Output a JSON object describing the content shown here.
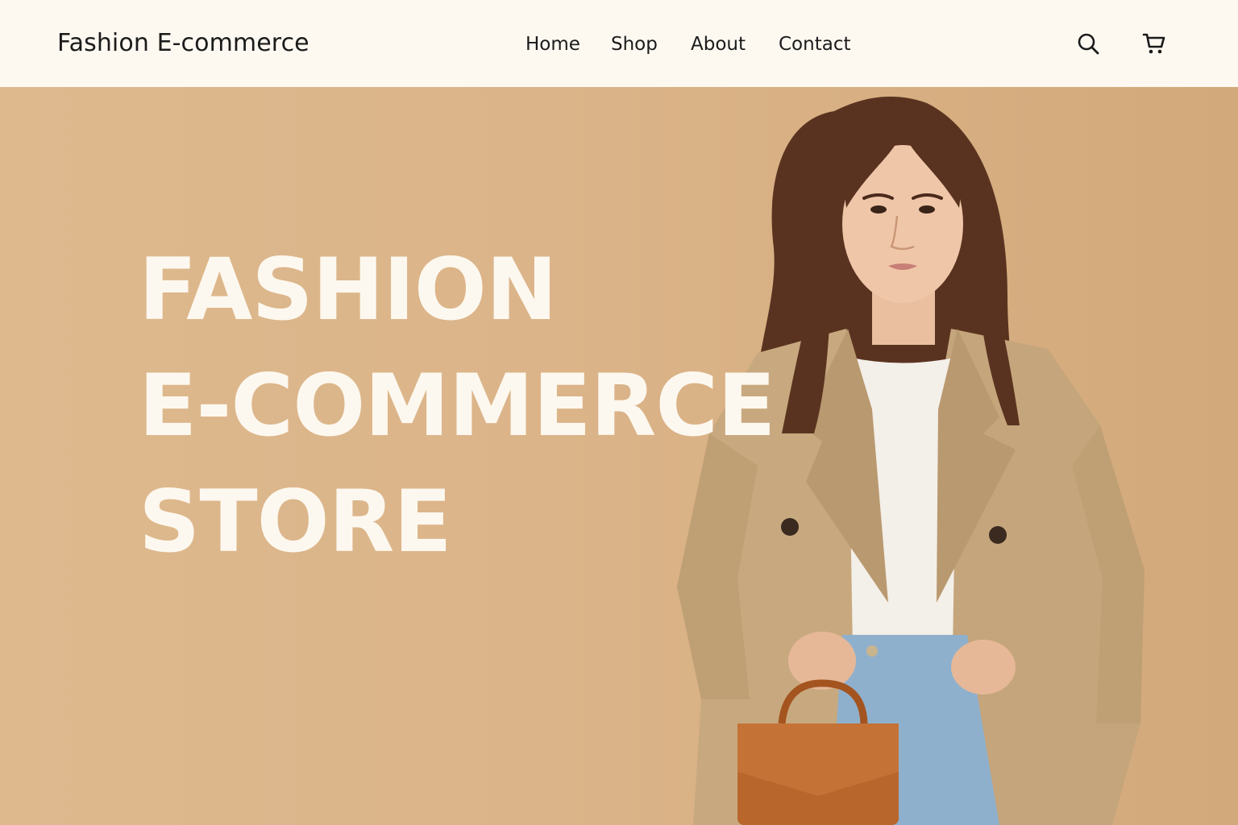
{
  "header": {
    "brand": "Fashion E-commerce",
    "nav": [
      {
        "label": "Home"
      },
      {
        "label": "Shop"
      },
      {
        "label": "About"
      },
      {
        "label": "Contact"
      }
    ],
    "icons": {
      "search": "search-icon",
      "cart": "cart-icon"
    }
  },
  "hero": {
    "title_lines": [
      "FASHION",
      "E-COMMERCE",
      "STORE"
    ]
  },
  "colors": {
    "header_bg": "#fdf9f1",
    "hero_bg": "#dcb68a",
    "hero_text": "#fdf8ef",
    "nav_text": "#1b1b1b",
    "coat": "#c8a97f",
    "bag": "#b8662c",
    "jeans": "#8fb0cc"
  }
}
